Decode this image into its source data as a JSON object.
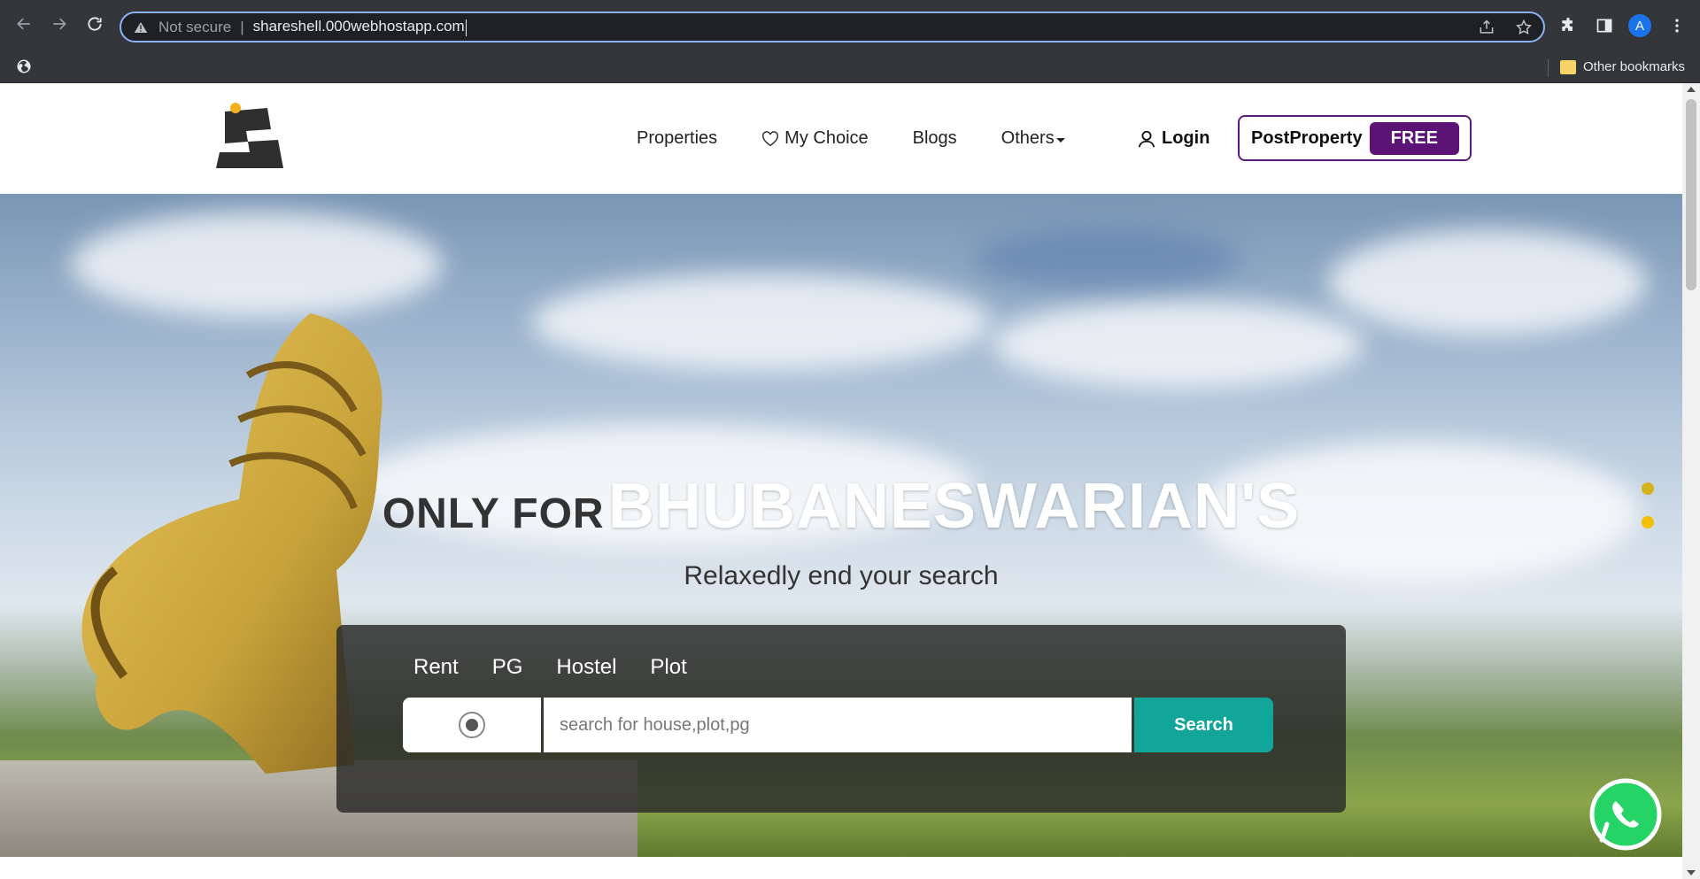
{
  "browser": {
    "security_label": "Not secure",
    "separator": "|",
    "url": "shareshell.000webhostapp.com",
    "profile_initial": "A",
    "bookmarks": {
      "other_label": "Other bookmarks"
    }
  },
  "site": {
    "nav": {
      "properties": "Properties",
      "my_choice": "My Choice",
      "blogs": "Blogs",
      "others": "Others"
    },
    "login": "Login",
    "post_property": {
      "label": "PostProperty",
      "badge": "FREE"
    },
    "hero": {
      "title_prefix": "ONLY FOR",
      "title_main": "BHUBANESWARIAN'S",
      "subtitle": "Relaxedly end your search"
    },
    "search": {
      "tabs": [
        "Rent",
        "PG",
        "Hostel",
        "Plot"
      ],
      "placeholder": "search for house,plot,pg",
      "button": "Search"
    },
    "carousel": {
      "count": 2,
      "active_index": 1
    },
    "colors": {
      "accent_purple": "#5b1476",
      "search_teal": "#12a59a",
      "dot_yellow": "#f2c000"
    }
  }
}
